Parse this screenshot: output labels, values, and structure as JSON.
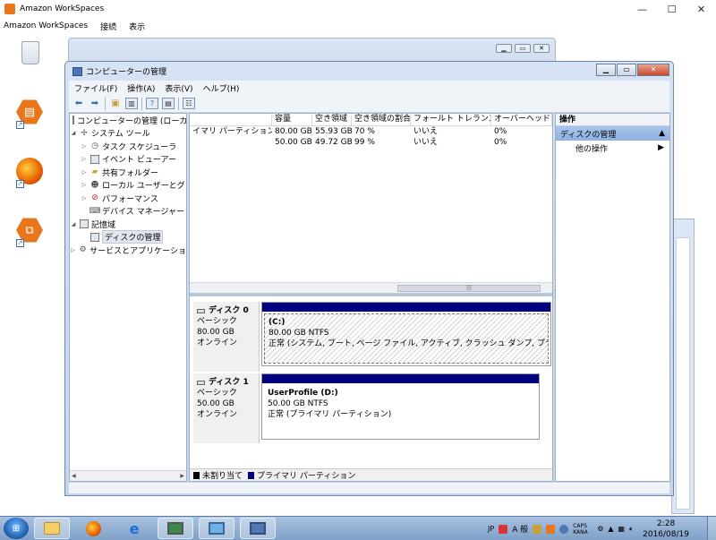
{
  "outer": {
    "title": "Amazon WorkSpaces",
    "menu": [
      "Amazon WorkSpaces",
      "接続",
      "表示"
    ],
    "controls": {
      "minimize": "—",
      "maximize": "☐",
      "close": "✕"
    }
  },
  "mmc": {
    "title": "コンピューターの管理",
    "menu": [
      "ファイル(F)",
      "操作(A)",
      "表示(V)",
      "ヘルプ(H)"
    ],
    "tree": [
      {
        "label": "コンピューターの管理 (ローカ",
        "icon": "computer-icon",
        "depth": 0,
        "toggle": ""
      },
      {
        "label": "システム ツール",
        "icon": "tools-icon",
        "depth": 1,
        "toggle": "◢"
      },
      {
        "label": "タスク スケジューラ",
        "icon": "clock-icon",
        "depth": 2,
        "toggle": "▷"
      },
      {
        "label": "イベント ビューアー",
        "icon": "event-icon",
        "depth": 2,
        "toggle": "▷"
      },
      {
        "label": "共有フォルダー",
        "icon": "folder-icon",
        "depth": 2,
        "toggle": "▷"
      },
      {
        "label": "ローカル ユーザーとグ",
        "icon": "users-icon",
        "depth": 2,
        "toggle": "▷"
      },
      {
        "label": "パフォーマンス",
        "icon": "performance-icon",
        "depth": 2,
        "toggle": "▷"
      },
      {
        "label": "デバイス マネージャー",
        "icon": "device-icon",
        "depth": 2,
        "toggle": ""
      },
      {
        "label": "記憶域",
        "icon": "storage-icon",
        "depth": 1,
        "toggle": "◢"
      },
      {
        "label": "ディスクの管理",
        "icon": "disk-mgmt-icon",
        "depth": 2,
        "toggle": "",
        "selected": true
      },
      {
        "label": "サービスとアプリケーショ",
        "icon": "services-icon",
        "depth": 1,
        "toggle": "▷"
      }
    ],
    "volumes": {
      "headers": [
        "",
        "容量",
        "空き領域",
        "空き領域の割合",
        "フォールト トレランス",
        "オーバーヘッド"
      ],
      "rows": [
        [
          "イマリ パーティション)",
          "80.00 GB",
          "55.93 GB",
          "70 %",
          "いいえ",
          "0%"
        ],
        [
          "",
          "50.00 GB",
          "49.72 GB",
          "99 %",
          "いいえ",
          "0%"
        ]
      ]
    },
    "disks": [
      {
        "name": "ディスク 0",
        "type": "ベーシック",
        "size": "80.00 GB",
        "status": "オンライン",
        "partition": {
          "name": "(C:)",
          "fs": "80.00 GB NTFS",
          "state": "正常 (システム, ブート, ページ ファイル, アクティブ, クラッシュ ダンプ, プライマリ"
        }
      },
      {
        "name": "ディスク 1",
        "type": "ベーシック",
        "size": "50.00 GB",
        "status": "オンライン",
        "partition": {
          "name": "UserProfile  (D:)",
          "fs": "50.00 GB NTFS",
          "state": "正常 (プライマリ パーティション)"
        }
      }
    ],
    "legend": {
      "unallocated": "未割り当て",
      "primary": "プライマリ パーティション"
    },
    "actions": {
      "header": "操作",
      "selected": "ディスクの管理",
      "other": "他の操作"
    }
  },
  "taskbar": {
    "tray": {
      "lang": "JP",
      "ime": "A 般",
      "caps": "CAPS KANA"
    },
    "time": "2:28",
    "date": "2016/08/19"
  },
  "colors": {
    "partition_primary": "#00007f",
    "accent": "#e8771c"
  }
}
